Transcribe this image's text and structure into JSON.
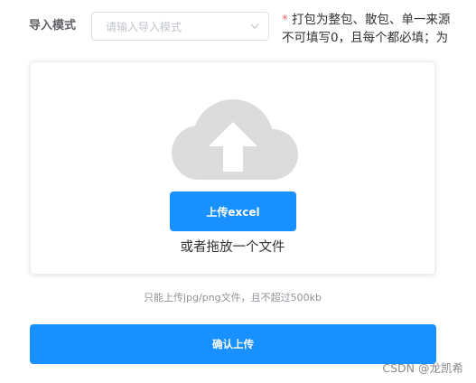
{
  "form": {
    "mode_label": "导入模式",
    "mode_placeholder": "请输入导入模式",
    "note_star": "*",
    "note_line1": " 打包为整包、散包、单一来源",
    "note_line2": "不可填写0，且每个都必填；为"
  },
  "upload": {
    "button_label": "上传excel",
    "drag_text": "或者拖放一个文件",
    "tip": "只能上传jpg/png文件，且不超过500kb",
    "icon": "cloud-upload-icon"
  },
  "actions": {
    "confirm_label": "确认上传"
  },
  "watermark": "CSDN @龙凯希",
  "colors": {
    "primary": "#1890ff",
    "required_star": "#f56c6c",
    "cloud_icon": "#dcdcdc"
  }
}
